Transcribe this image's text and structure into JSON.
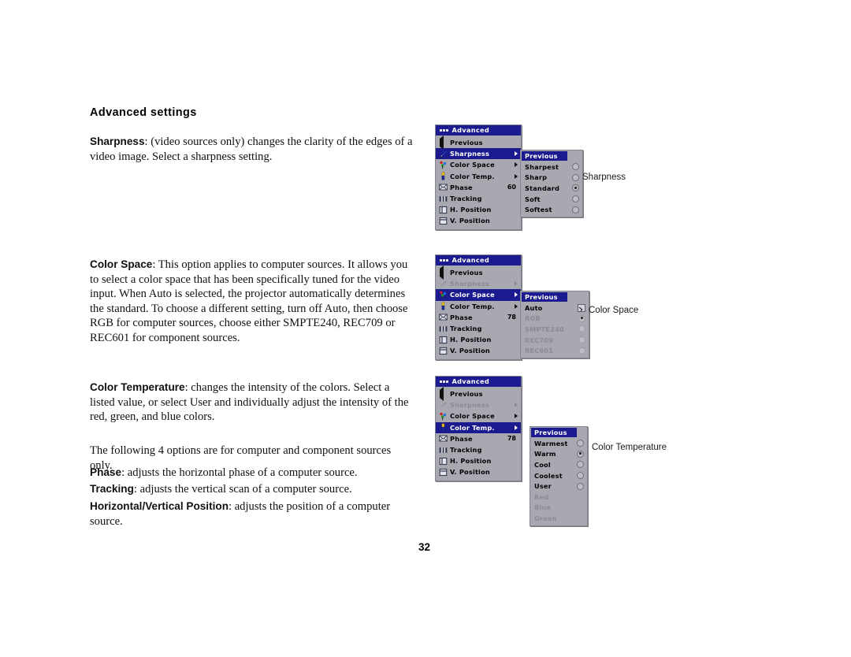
{
  "page": {
    "number": "32",
    "heading": "Advanced settings"
  },
  "paragraphs": {
    "sharpness": {
      "term": "Sharpness",
      "text": ": (video sources only) changes the clarity of the edges of a video image. Select a sharpness setting."
    },
    "color_space": {
      "term": "Color Space",
      "text": ": This option applies to computer sources. It allows you to select a color space that has been specifically tuned for the video input. When Auto is selected, the projector automatically determines the standard. To choose a different setting, turn off Auto, then choose RGB for computer sources, choose either SMPTE240, REC709 or REC601 for component sources."
    },
    "color_temperature": {
      "term": "Color Temperature",
      "text": ": changes the intensity of the colors. Select a listed value, or select User and individually adjust the intensity of the red, green, and blue colors."
    },
    "note": {
      "text": "The following 4 options are for computer and component sources only."
    },
    "phase": {
      "term": "Phase",
      "text": ": adjusts the horizontal phase of a computer source."
    },
    "tracking": {
      "term": "Tracking",
      "text": ": adjusts the vertical scan of a computer source."
    },
    "hv_position": {
      "term": "Horizontal/Vertical Position",
      "text": ": adjusts the position of a computer source."
    }
  },
  "colors": {
    "menu_title_bg": "#1b1b8f",
    "menu_bg": "#a8a8b0",
    "menu_highlight": "#1b1b8f",
    "menu_text": "#000000",
    "menu_text_disabled": "#8b8b94",
    "menu_text_selected": "#ffffff"
  },
  "figures": [
    {
      "id": "sharpness",
      "caption": "Sharpness",
      "menu": {
        "title": "Advanced",
        "items": [
          {
            "label": "Previous",
            "icon": "back-arrow-icon",
            "kind": "back"
          },
          {
            "label": "Sharpness",
            "icon": "pen-icon",
            "kind": "submenu",
            "state": "selected"
          },
          {
            "label": "Color Space",
            "icon": "color-dots-icon",
            "kind": "submenu",
            "state": "normal"
          },
          {
            "label": "Color Temp.",
            "icon": "thermometer-icon",
            "kind": "submenu",
            "state": "normal"
          },
          {
            "label": "Phase",
            "icon": "phase-icon",
            "kind": "value",
            "value": "60",
            "state": "normal"
          },
          {
            "label": "Tracking",
            "icon": "tracking-icon",
            "kind": "plain",
            "state": "normal"
          },
          {
            "label": "H. Position",
            "icon": "h-position-icon",
            "kind": "plain",
            "state": "normal"
          },
          {
            "label": "V. Position",
            "icon": "v-position-icon",
            "kind": "plain",
            "state": "normal"
          }
        ]
      },
      "submenu": {
        "header": "Previous",
        "control": "radio",
        "options": [
          {
            "label": "Sharpest",
            "selected": false,
            "disabled": false
          },
          {
            "label": "Sharp",
            "selected": false,
            "disabled": false
          },
          {
            "label": "Standard",
            "selected": true,
            "disabled": false
          },
          {
            "label": "Soft",
            "selected": false,
            "disabled": false
          },
          {
            "label": "Softest",
            "selected": false,
            "disabled": false
          }
        ]
      }
    },
    {
      "id": "color-space",
      "caption": "Color Space",
      "menu": {
        "title": "Advanced",
        "items": [
          {
            "label": "Previous",
            "icon": "back-arrow-icon",
            "kind": "back"
          },
          {
            "label": "Sharpness",
            "icon": "pen-icon",
            "kind": "submenu",
            "state": "disabled"
          },
          {
            "label": "Color Space",
            "icon": "color-dots-icon",
            "kind": "submenu",
            "state": "selected"
          },
          {
            "label": "Color Temp.",
            "icon": "thermometer-icon",
            "kind": "submenu",
            "state": "normal"
          },
          {
            "label": "Phase",
            "icon": "phase-icon",
            "kind": "value",
            "value": "78",
            "state": "normal"
          },
          {
            "label": "Tracking",
            "icon": "tracking-icon",
            "kind": "plain",
            "state": "normal"
          },
          {
            "label": "H. Position",
            "icon": "h-position-icon",
            "kind": "plain",
            "state": "normal"
          },
          {
            "label": "V. Position",
            "icon": "v-position-icon",
            "kind": "plain",
            "state": "normal"
          }
        ]
      },
      "submenu": {
        "header": "Previous",
        "control": "mixed",
        "options": [
          {
            "label": "Auto",
            "selected": true,
            "disabled": false,
            "control": "checkbox"
          },
          {
            "label": "RGB",
            "selected": true,
            "disabled": true,
            "control": "radio"
          },
          {
            "label": "SMPTE240",
            "selected": false,
            "disabled": true,
            "control": "radio"
          },
          {
            "label": "REC709",
            "selected": false,
            "disabled": true,
            "control": "radio"
          },
          {
            "label": "REC601",
            "selected": false,
            "disabled": true,
            "control": "radio"
          }
        ]
      }
    },
    {
      "id": "color-temperature",
      "caption": "Color Temperature",
      "menu": {
        "title": "Advanced",
        "items": [
          {
            "label": "Previous",
            "icon": "back-arrow-icon",
            "kind": "back"
          },
          {
            "label": "Sharpness",
            "icon": "pen-icon",
            "kind": "submenu",
            "state": "disabled"
          },
          {
            "label": "Color Space",
            "icon": "color-dots-icon",
            "kind": "submenu",
            "state": "normal"
          },
          {
            "label": "Color Temp.",
            "icon": "thermometer-icon",
            "kind": "submenu",
            "state": "selected"
          },
          {
            "label": "Phase",
            "icon": "phase-icon",
            "kind": "value",
            "value": "78",
            "state": "normal"
          },
          {
            "label": "Tracking",
            "icon": "tracking-icon",
            "kind": "plain",
            "state": "normal"
          },
          {
            "label": "H. Position",
            "icon": "h-position-icon",
            "kind": "plain",
            "state": "normal"
          },
          {
            "label": "V. Position",
            "icon": "v-position-icon",
            "kind": "plain",
            "state": "normal"
          }
        ]
      },
      "submenu": {
        "header": "Previous",
        "control": "radio",
        "options": [
          {
            "label": "Warmest",
            "selected": false,
            "disabled": false,
            "control": "radio"
          },
          {
            "label": "Warm",
            "selected": true,
            "disabled": false,
            "control": "radio"
          },
          {
            "label": "Cool",
            "selected": false,
            "disabled": false,
            "control": "radio"
          },
          {
            "label": "Coolest",
            "selected": false,
            "disabled": false,
            "control": "radio"
          },
          {
            "label": "User",
            "selected": false,
            "disabled": false,
            "control": "radio"
          },
          {
            "label": "Red",
            "selected": false,
            "disabled": true,
            "control": "none"
          },
          {
            "label": "Blue",
            "selected": false,
            "disabled": true,
            "control": "none"
          },
          {
            "label": "Green",
            "selected": false,
            "disabled": true,
            "control": "none"
          }
        ]
      }
    }
  ]
}
